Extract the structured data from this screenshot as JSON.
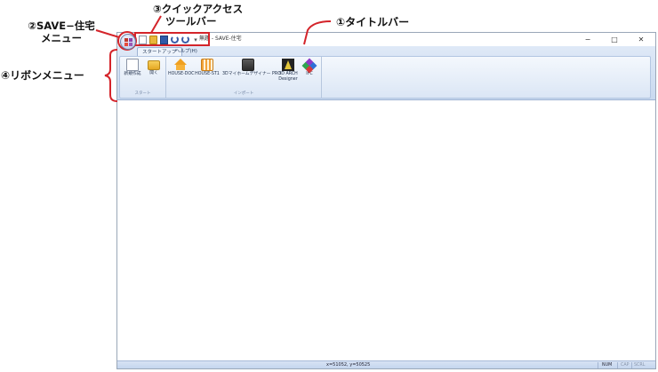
{
  "annotations": {
    "app_menu_line1": "②SAVE−住宅",
    "app_menu_line2": "メニュー",
    "qat_line1": "③クイックアクセス",
    "qat_line2": "ツールバー",
    "titlebar": "①タイトルバー",
    "ribbon": "④リボンメニュー"
  },
  "window": {
    "title": "無題 - SAVE-住宅",
    "controls": {
      "minimize": "−",
      "maximize": "□",
      "close": "✕"
    },
    "qat_more": "▾"
  },
  "ribbon": {
    "tabs": [
      "スタートアップ",
      "ヘルプ(H)"
    ],
    "groups": [
      {
        "label": "スタート",
        "buttons": [
          "新規作成",
          "開く"
        ]
      },
      {
        "label": "インポート",
        "buttons": [
          "HOUSE-DOC",
          "HOUSE-ST1",
          "3Dマイホームデザイナー PRO",
          "3D ARCH Designer",
          "IFC"
        ]
      }
    ]
  },
  "statusbar": {
    "coords": "x=51052, y=50525",
    "num": "NUM",
    "cap": "CAP",
    "scrl": "SCRL"
  },
  "colors": {
    "ribbon_bg": "#dfe9f7",
    "statusbar_bg": "#c9d9ef",
    "annotation_red": "#d4242a"
  },
  "icons": [
    "app-menu-icon",
    "new-doc-icon",
    "open-folder-icon",
    "save-icon",
    "undo-icon",
    "redo-icon",
    "house-icon",
    "grid-icon",
    "camera-icon",
    "arch-icon",
    "ifc-icon"
  ]
}
